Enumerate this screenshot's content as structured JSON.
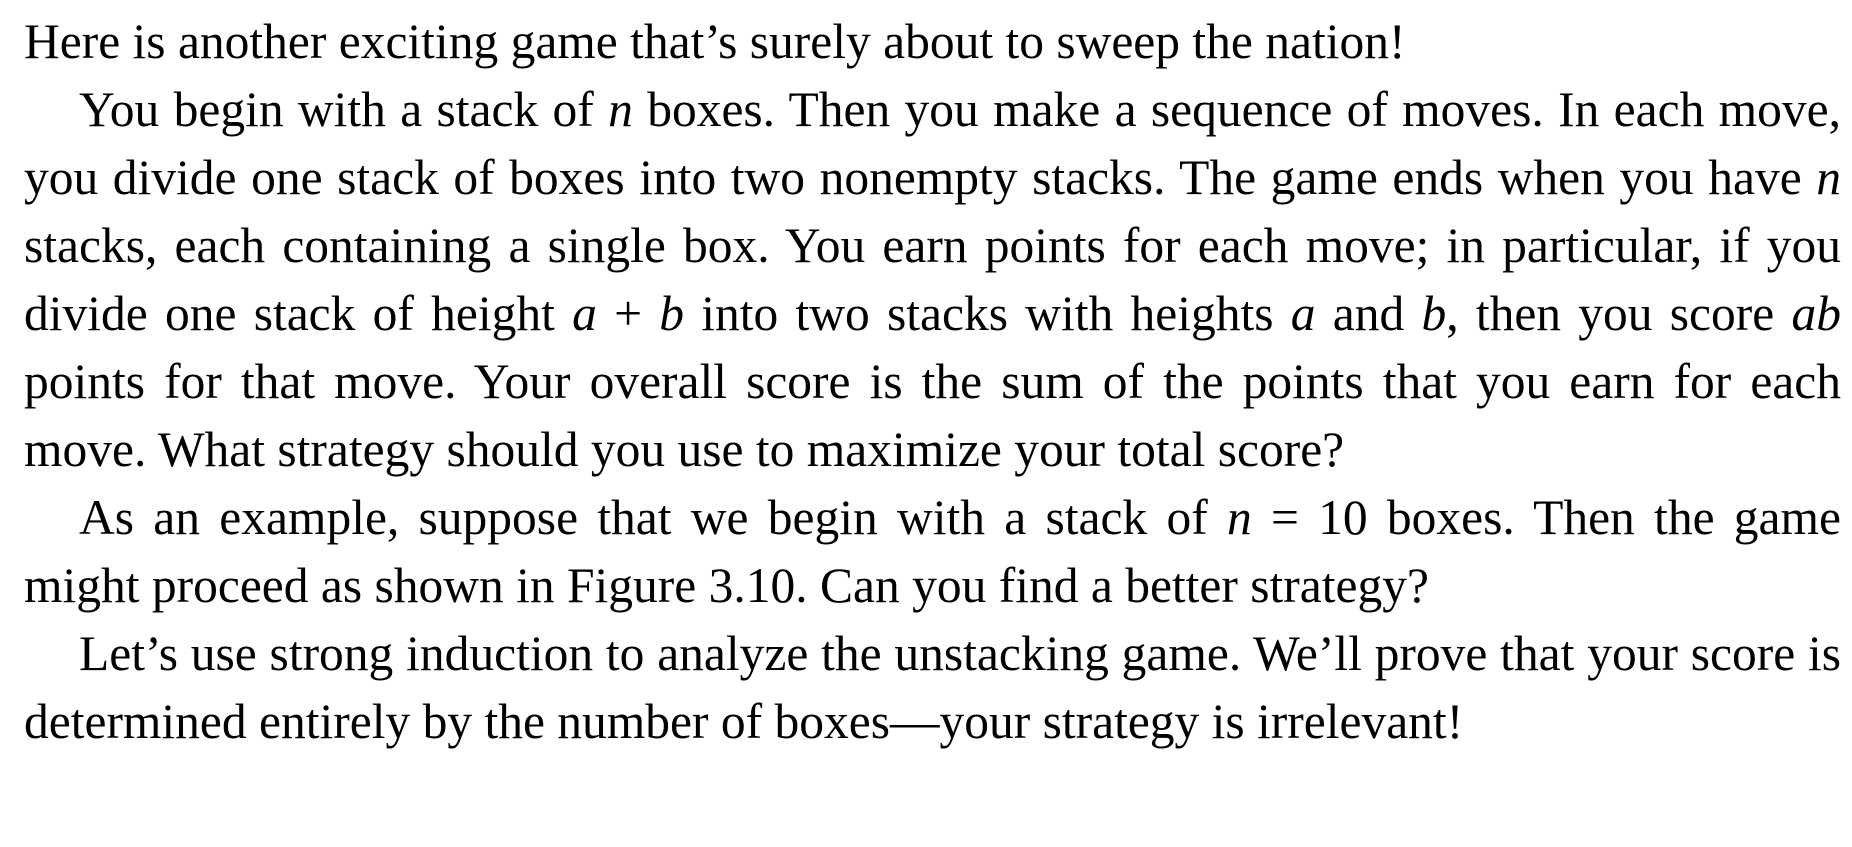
{
  "paragraphs": [
    {
      "id": "intro",
      "text": "Here is another exciting game that’s surely about to sweep the nation!"
    },
    {
      "id": "rules",
      "segments": [
        {
          "text": "You begin with a stack of "
        },
        {
          "text": "n",
          "math": true
        },
        {
          "text": " boxes. Then you make a sequence of moves. In each move, you divide one stack of boxes into two nonempty stacks.  The game ends when you have "
        },
        {
          "text": "n",
          "math": true
        },
        {
          "text": " stacks, each containing a single box.  You earn points for each move; in particular, if you divide one stack of height "
        },
        {
          "text": "a",
          "math": true
        },
        {
          "text": " + "
        },
        {
          "text": "b",
          "math": true
        },
        {
          "text": " into two stacks with heights "
        },
        {
          "text": "a",
          "math": true
        },
        {
          "text": " and "
        },
        {
          "text": "b",
          "math": true
        },
        {
          "text": ", then you score "
        },
        {
          "text": "ab",
          "math": true
        },
        {
          "text": " points for that move.  Your overall score is the sum of the points that you earn for each move.  What strategy should you use to maximize your total score?"
        }
      ]
    },
    {
      "id": "example",
      "segments": [
        {
          "text": "As an example, suppose that we begin with a stack of "
        },
        {
          "text": "n",
          "math": true
        },
        {
          "text": " = 10 boxes.  Then the game might proceed as shown in Figure 3.10.  Can you find a better strategy?"
        }
      ]
    },
    {
      "id": "induction",
      "text": "Let’s use strong induction to analyze the unstacking game.  We’ll prove that your score is determined entirely by the number of boxes—your strategy is irrelevant!"
    }
  ]
}
